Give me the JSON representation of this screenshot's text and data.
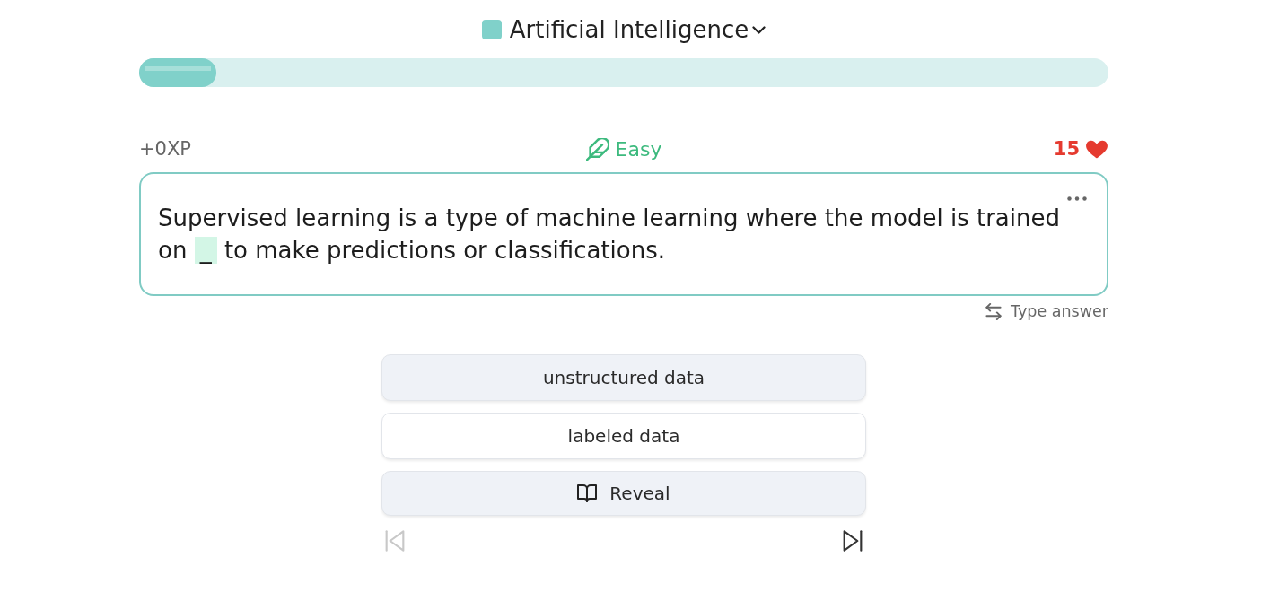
{
  "topic": {
    "title": "Artificial Intelligence"
  },
  "progress": {
    "level": 0.08
  },
  "stats": {
    "xp": "+0XP",
    "difficulty": "Easy",
    "lives": "15"
  },
  "question": {
    "before": "Supervised learning is a type of machine learning where the model is trained on",
    "blank": "_",
    "after": "to make predictions or classifications."
  },
  "mode_toggle": {
    "label": "Type answer"
  },
  "options": [
    {
      "label": "unstructured data",
      "selected": true
    },
    {
      "label": "labeled data",
      "selected": false
    }
  ],
  "reveal_button": {
    "label": "Reveal"
  },
  "nav_buttons": [
    {
      "kind": "previous",
      "disabled": true
    },
    {
      "kind": "next",
      "disabled": false
    }
  ]
}
